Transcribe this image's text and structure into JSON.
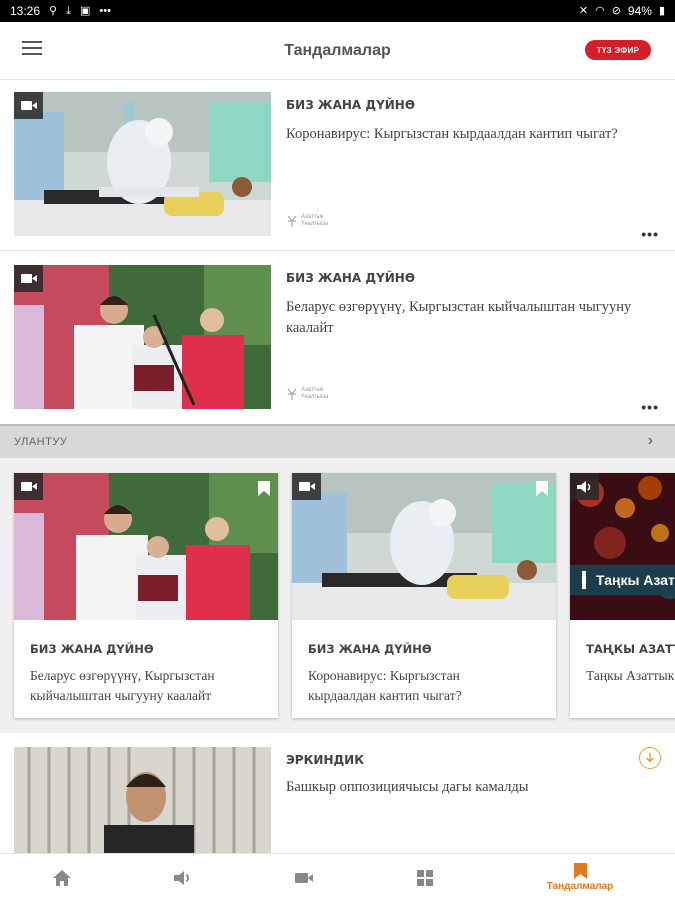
{
  "status_bar": {
    "time": "13:26",
    "battery": "94%"
  },
  "header": {
    "title": "Тандалмалар",
    "live_label": "ТҮЗ ЭФИР"
  },
  "articles": [
    {
      "category": "БИЗ ЖАНА ДҮЙНӨ",
      "title": "Коронавирус: Кыргызстан кырдаалдан кантип чыгат?",
      "source": "Азаттык Үналгысы",
      "more": "•••"
    },
    {
      "category": "БИЗ ЖАНА ДҮЙНӨ",
      "title": "Беларус өзгөрүүнү, Кыргызстан кыйчалыштан чыгууну каалайт",
      "source": "Азаттык Үналгысы",
      "more": "•••"
    }
  ],
  "section": {
    "label": "УЛАНТУУ",
    "chevron": "›"
  },
  "cards": [
    {
      "category": "БИЗ ЖАНА ДҮЙНӨ",
      "title_line1": "Беларус өзгөрүүнү, Кыргызстан",
      "title_line2": "кыйчалыштан чыгууну каалайт"
    },
    {
      "category": "БИЗ ЖАНА ДҮЙНӨ",
      "title_line1": "Коронавирус: Кыргызстан",
      "title_line2": "кырдаалдан кантип чыгат?"
    },
    {
      "category": "ТАҢКЫ АЗАТТЫК",
      "title_line1": "Таңкы Азаттык",
      "title_line2": "",
      "overlay_text": "Таңкы Азаттык"
    }
  ],
  "article3": {
    "category": "ЭРКИНДИК",
    "title": "Башкыр оппозициячысы дагы камалды"
  },
  "bottom_nav": {
    "items": [
      {
        "icon": "home-icon"
      },
      {
        "icon": "audio-icon"
      },
      {
        "icon": "video-icon"
      },
      {
        "icon": "grid-icon"
      },
      {
        "icon": "bookmark-icon",
        "label": "Тандалмалар",
        "active": true
      }
    ]
  },
  "colors": {
    "accent": "#e07a1f",
    "live": "#d41f2b",
    "download": "#e2a336"
  }
}
